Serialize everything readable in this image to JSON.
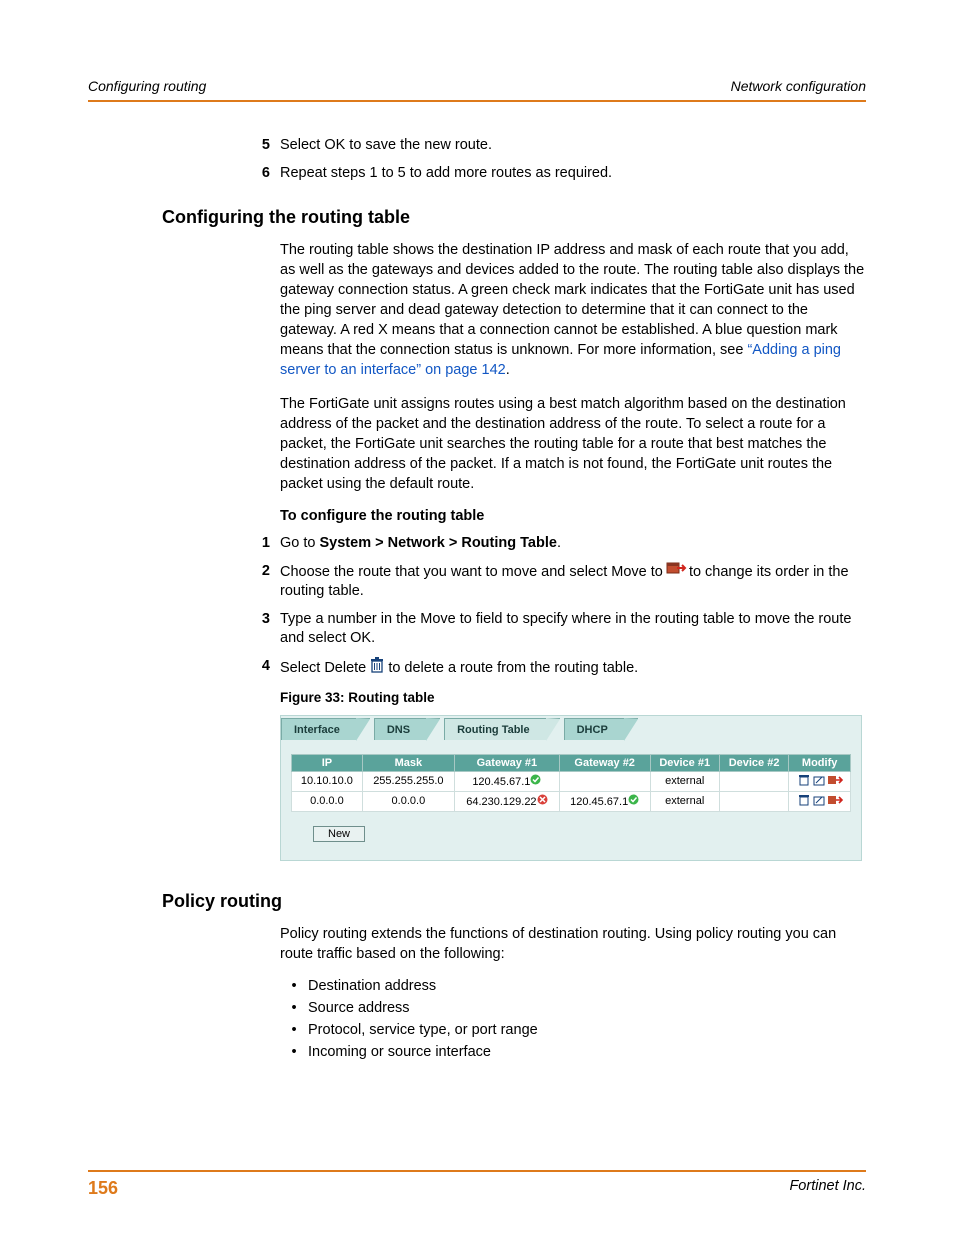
{
  "header": {
    "left": "Configuring routing",
    "right": "Network configuration"
  },
  "top_steps": [
    {
      "n": "5",
      "t": "Select OK to save the new route."
    },
    {
      "n": "6",
      "t": "Repeat steps 1 to 5 to add more routes as required."
    }
  ],
  "h_conf": "Configuring the routing table",
  "p1a": "The routing table shows the destination IP address and mask of each route that you add, as well as the gateways and devices added to the route. The routing table also displays the gateway connection status. A green check mark indicates that the FortiGate unit has used the ping server and dead gateway detection to determine that it can connect to the gateway. A red X means that a connection cannot be established. A blue question mark means that the connection status is unknown. For more information, see ",
  "p1link": "“Adding a ping server to an interface” on page 142",
  "p1b": ".",
  "p2": "The FortiGate unit assigns routes using a best match algorithm based on the destination address of the packet and the destination address of the route. To select a route for a packet, the FortiGate unit searches the routing table for a route that best matches the destination address of the packet. If a match is not found, the FortiGate unit routes the packet using the default route.",
  "subhead": "To configure the routing table",
  "steps2": {
    "s1n": "1",
    "s1a": "Go to ",
    "s1b": "System > Network > Routing Table",
    "s1c": ".",
    "s2n": "2",
    "s2a": "Choose the route that you want to move and select Move to ",
    "s2b": " to change its order in the routing table.",
    "s3n": "3",
    "s3": "Type a number in the Move to field to specify where in the routing table to move the route and select OK.",
    "s4n": "4",
    "s4a": "Select Delete ",
    "s4b": " to delete a route from the routing table."
  },
  "fig_caption": "Figure 33: Routing table",
  "tabs": {
    "t1": "Interface",
    "t2": "DNS",
    "t3": "Routing Table",
    "t4": "DHCP"
  },
  "rt": {
    "headers": {
      "ip": "IP",
      "mask": "Mask",
      "gw1": "Gateway #1",
      "gw2": "Gateway #2",
      "d1": "Device #1",
      "d2": "Device #2",
      "mod": "Modify"
    },
    "rows": [
      {
        "ip": "10.10.10.0",
        "mask": "255.255.255.0",
        "gw1": "120.45.67.1",
        "gw1s": "ok",
        "gw2": "",
        "gw2s": "",
        "d1": "external",
        "d2": ""
      },
      {
        "ip": "0.0.0.0",
        "mask": "0.0.0.0",
        "gw1": "64.230.129.22",
        "gw1s": "bad",
        "gw2": "120.45.67.1",
        "gw2s": "ok",
        "d1": "external",
        "d2": ""
      }
    ],
    "newbtn": "New"
  },
  "h_policy": "Policy routing",
  "p3": "Policy routing extends the functions of destination routing. Using policy routing you can route traffic based on the following:",
  "bullets": [
    "Destination address",
    "Source address",
    "Protocol, service type, or port range",
    "Incoming or source interface"
  ],
  "footer": {
    "page": "156",
    "pub": "Fortinet Inc."
  }
}
